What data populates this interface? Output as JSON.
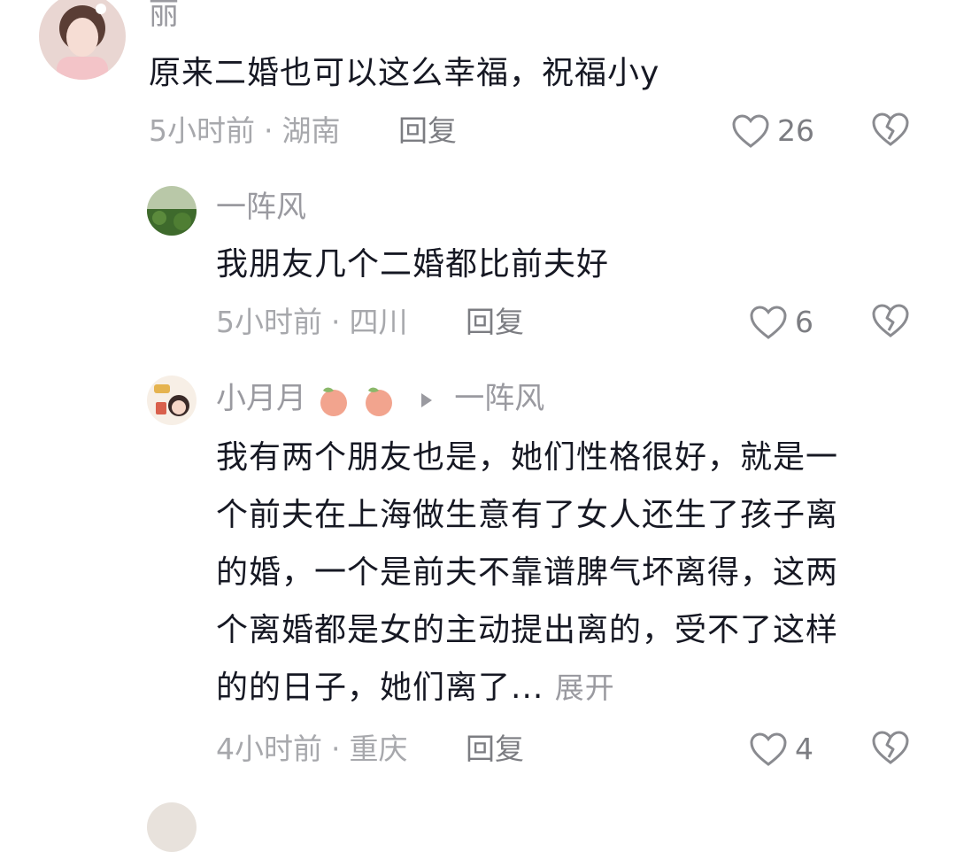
{
  "comments": [
    {
      "username": "丽",
      "text": "原来二婚也可以这么幸福，祝福小y",
      "time": "5小时前",
      "location": "湖南",
      "reply_label": "回复",
      "likes": "26"
    },
    {
      "username": "一阵风",
      "text": "我朋友几个二婚都比前夫好",
      "time": "5小时前",
      "location": "四川",
      "reply_label": "回复",
      "likes": "6"
    },
    {
      "username": "小月月",
      "reply_to": "一阵风",
      "text_lines": [
        "我有两个朋友也是，她们性格很好，就是一",
        "个前夫在上海做生意有了女人还生了孩子离",
        "的婚，一个是前夫不靠谱脾气坏离得，这两",
        "个离婚都是女的主动提出离的，受不了这样",
        "的的日子，她们离了..."
      ],
      "expand_label": "展开",
      "time": "4小时前",
      "location": "重庆",
      "reply_label": "回复",
      "likes": "4"
    }
  ],
  "meta_separator": "·",
  "icons": {
    "like": "heart-outline-icon",
    "dislike": "broken-heart-icon",
    "badge": "peach-icon",
    "reply_arrow": "play-triangle-icon"
  },
  "colors": {
    "text": "#161823",
    "secondary": "#9a9aa0",
    "peach": "#f2a48e"
  }
}
